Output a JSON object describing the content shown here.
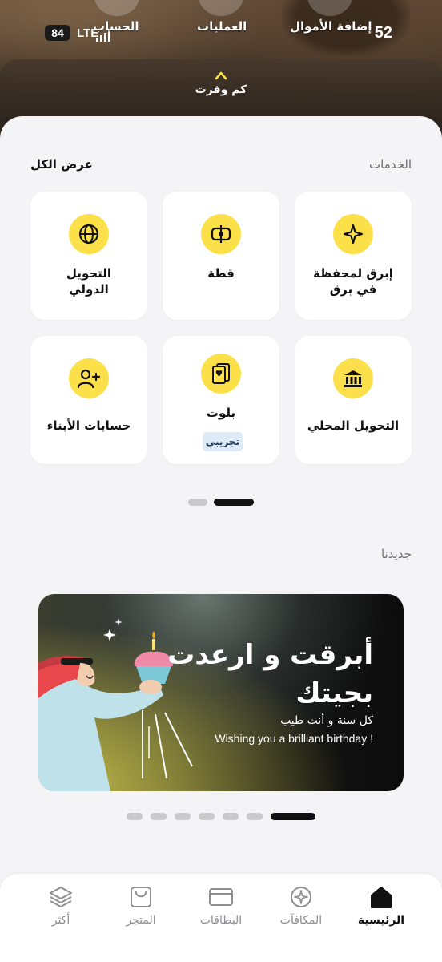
{
  "status_bar": {
    "battery": "84",
    "network": "LTE",
    "time": "52"
  },
  "quick_actions": [
    {
      "label": "الحساب"
    },
    {
      "label": "العمليات"
    },
    {
      "label": "إضافة الأموال"
    }
  ],
  "savings": {
    "label": "كم وفرت",
    "icon": "chevron-up-icon"
  },
  "services": {
    "title": "الخدمات",
    "view_all": "عرض الكل",
    "items": [
      {
        "label": "إبرق لمحفظة\nفي برق",
        "icon": "spark-icon"
      },
      {
        "label": "قطة",
        "icon": "split-coin-icon"
      },
      {
        "label": "التحويل\nالدولي",
        "icon": "globe-icon"
      },
      {
        "label": "التحويل المحلي",
        "icon": "bank-icon"
      },
      {
        "label": "بلوت",
        "icon": "playing-card-icon",
        "badge": "تجريبي"
      },
      {
        "label": "حسابات الأبناء",
        "icon": "add-user-icon"
      }
    ],
    "pager": {
      "count": 2,
      "active": 1
    }
  },
  "whats_new": {
    "title": "جديدنا",
    "banner": {
      "title": "أبرقت و ارعدت\nبجيتك",
      "subtitle_ar": "كل سنة و أنت طيب",
      "subtitle_en": "Wishing you a brilliant birthday !"
    },
    "pager": {
      "count": 7,
      "active": 6
    }
  },
  "bottom_nav": [
    {
      "label": "الرئيسية",
      "icon": "home-icon",
      "active": true
    },
    {
      "label": "المكافآت",
      "icon": "rewards-icon",
      "active": false
    },
    {
      "label": "البطاقات",
      "icon": "card-icon",
      "active": false
    },
    {
      "label": "المتجر",
      "icon": "store-icon",
      "active": false
    },
    {
      "label": "أكثر",
      "icon": "layers-icon",
      "active": false
    }
  ],
  "colors": {
    "accent_yellow": "#fce04a",
    "background": "#f4f4f6",
    "text_primary": "#111111",
    "text_muted": "#8e8e93"
  }
}
